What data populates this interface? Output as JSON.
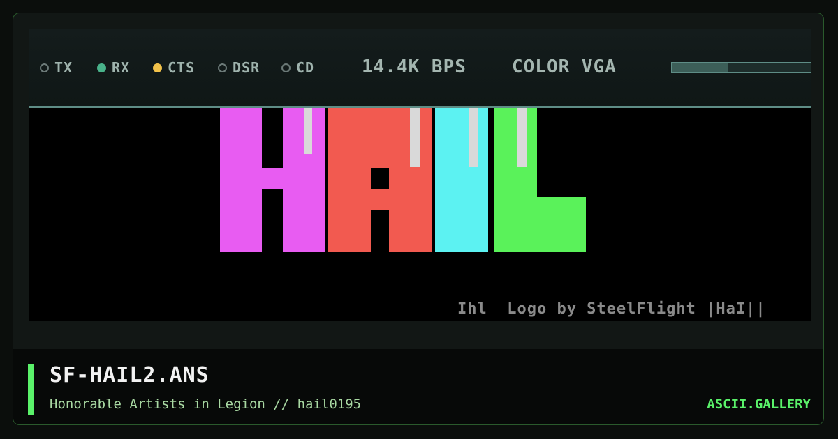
{
  "status_bar": {
    "indicators": [
      {
        "label": "TX",
        "state": "off"
      },
      {
        "label": "RX",
        "state": "green"
      },
      {
        "label": "CTS",
        "state": "yellow"
      },
      {
        "label": "DSR",
        "state": "off"
      },
      {
        "label": "CD",
        "state": "off"
      }
    ],
    "speed": "14.4K BPS",
    "mode": "COLOR VGA",
    "meter_level": 0.4
  },
  "artwork": {
    "logo_letters": [
      {
        "letter": "H",
        "color": "#e85cf2"
      },
      {
        "letter": "A",
        "color": "#f25a50"
      },
      {
        "letter": "I",
        "color": "#5cf2f2"
      },
      {
        "letter": "L",
        "color": "#5af25a"
      }
    ],
    "credit": "Ihl  Logo by SteelFlight |HaI||"
  },
  "footer": {
    "file_name": "SF-HAIL2.ANS",
    "meta": "Honorable Artists in Legion // hail0195",
    "site": "ASCII.GALLERY"
  },
  "colors": {
    "accent": "#5af26a",
    "led_green": "#49b28a",
    "led_yellow": "#f2c24a"
  }
}
